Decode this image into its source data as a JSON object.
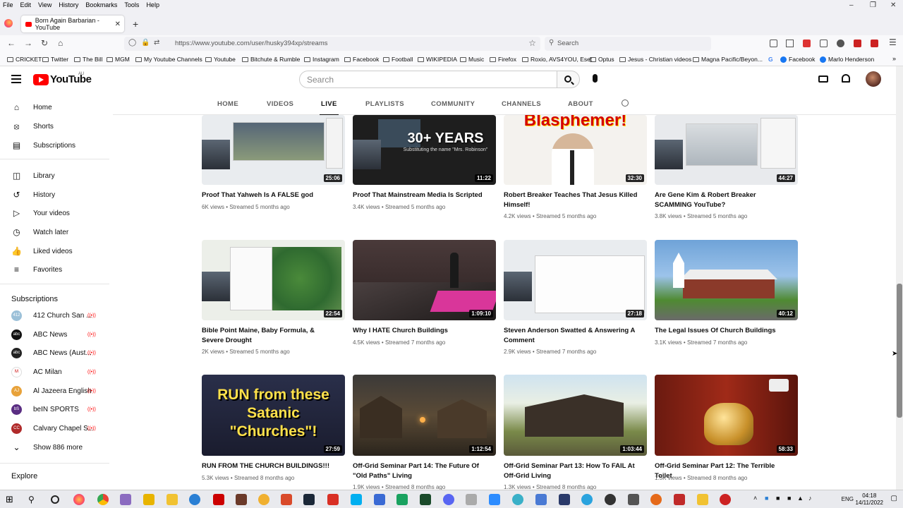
{
  "browser": {
    "menu": [
      "File",
      "Edit",
      "View",
      "History",
      "Bookmarks",
      "Tools",
      "Help"
    ],
    "tab_title": "Born Again Barbarian - YouTube",
    "url": "https://www.youtube.com/user/husky394xp/streams",
    "search_placeholder": "Search",
    "bookmarks": [
      "CRICKET",
      "Twitter",
      "The Bill",
      "MGM",
      "My Youtube Channels",
      "Youtube",
      "Bitchute & Rumble",
      "Instagram",
      "Facebook",
      "Football",
      "WIKIPEDIA",
      "Music",
      "Firefox",
      "Roxio, AVS4YOU, Eset",
      "Optus",
      "Jesus - Christian videos",
      "Magna Pacific/Beyon...",
      "Facebook",
      "Marlo Henderson"
    ]
  },
  "youtube": {
    "logo_text": "YouTube",
    "region": "AU",
    "search_placeholder": "Search"
  },
  "sidebar": {
    "main": [
      "Home",
      "Shorts",
      "Subscriptions"
    ],
    "library": [
      "Library",
      "History",
      "Your videos",
      "Watch later",
      "Liked videos",
      "Favorites"
    ],
    "subscriptions_heading": "Subscriptions",
    "subscriptions": [
      "412 Church San ...",
      "ABC News",
      "ABC News (Aust...",
      "AC Milan",
      "Al Jazeera English",
      "beIN SPORTS",
      "Calvary Chapel S..."
    ],
    "show_more": "Show 886 more",
    "explore_heading": "Explore"
  },
  "channel_tabs": [
    "HOME",
    "VIDEOS",
    "LIVE",
    "PLAYLISTS",
    "COMMUNITY",
    "CHANNELS",
    "ABOUT"
  ],
  "videos": [
    {
      "title": "Proof That Yahweh Is A FALSE god",
      "duration": "25:06",
      "views": "6K views",
      "age": "Streamed 5 months ago"
    },
    {
      "title": "Proof That Mainstream Media Is Scripted",
      "duration": "11:22",
      "views": "3.4K views",
      "age": "Streamed 5 months ago",
      "thumb_text": "30+ YEARS",
      "thumb_sub": "Substituting the name \"Mrs. Robinson\""
    },
    {
      "title": "Robert Breaker Teaches That Jesus Killed Himself!",
      "duration": "32:30",
      "views": "4.2K views",
      "age": "Streamed 5 months ago",
      "thumb_text": "Blasphemer!"
    },
    {
      "title": "Are Gene Kim & Robert Breaker SCAMMING YouTube?",
      "duration": "44:27",
      "views": "3.8K views",
      "age": "Streamed 5 months ago"
    },
    {
      "title": "Bible Point Maine, Baby Formula, & Severe Drought",
      "duration": "22:54",
      "views": "2K views",
      "age": "Streamed 5 months ago"
    },
    {
      "title": "Why I HATE Church Buildings",
      "duration": "1:09:10",
      "views": "4.5K views",
      "age": "Streamed 7 months ago"
    },
    {
      "title": "Steven Anderson Swatted & Answering A Comment",
      "duration": "27:18",
      "views": "2.9K views",
      "age": "Streamed 7 months ago"
    },
    {
      "title": "The Legal Issues Of Church Buildings",
      "duration": "40:12",
      "views": "3.1K views",
      "age": "Streamed 7 months ago"
    },
    {
      "title": "RUN FROM THE CHURCH BUILDINGS!!!",
      "duration": "27:59",
      "views": "5.3K views",
      "age": "Streamed 8 months ago",
      "thumb_text": "RUN from these Satanic \"Churches\"!"
    },
    {
      "title": "Off-Grid Seminar Part 14: The Future Of \"Old Paths\" Living",
      "duration": "1:12:54",
      "views": "1.9K views",
      "age": "Streamed 8 months ago"
    },
    {
      "title": "Off-Grid Seminar Part 13: How To FAIL At Off-Grid Living",
      "duration": "1:03:44",
      "views": "1.3K views",
      "age": "Streamed 8 months ago"
    },
    {
      "title": "Off-Grid Seminar Part 12: The Terrible Toilet",
      "duration": "58:33",
      "views": "1.5K views",
      "age": "Streamed 8 months ago"
    }
  ],
  "taskbar": {
    "lang": "ENG",
    "time": "04:18",
    "date": "14/11/2022"
  }
}
